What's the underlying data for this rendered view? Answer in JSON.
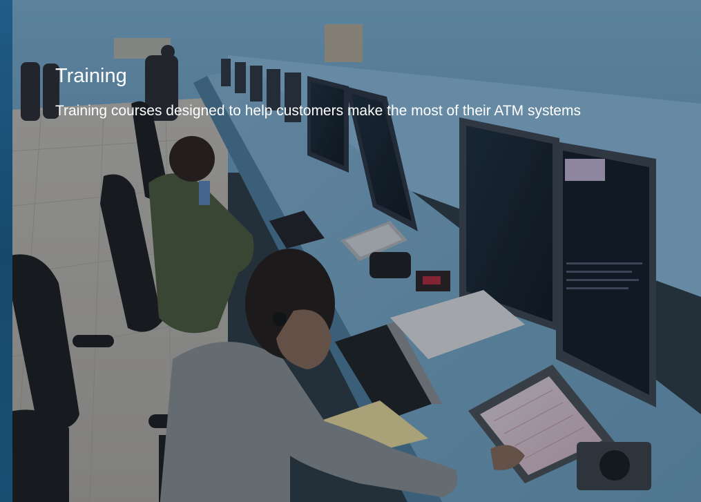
{
  "slide": {
    "title": "Training",
    "description": "Training courses designed to help customers make the most of their ATM systems"
  },
  "photo": {
    "subject": "air-traffic-control-training-room"
  },
  "colors": {
    "text": "#ffffff",
    "accent_band": "#1f5c86"
  }
}
